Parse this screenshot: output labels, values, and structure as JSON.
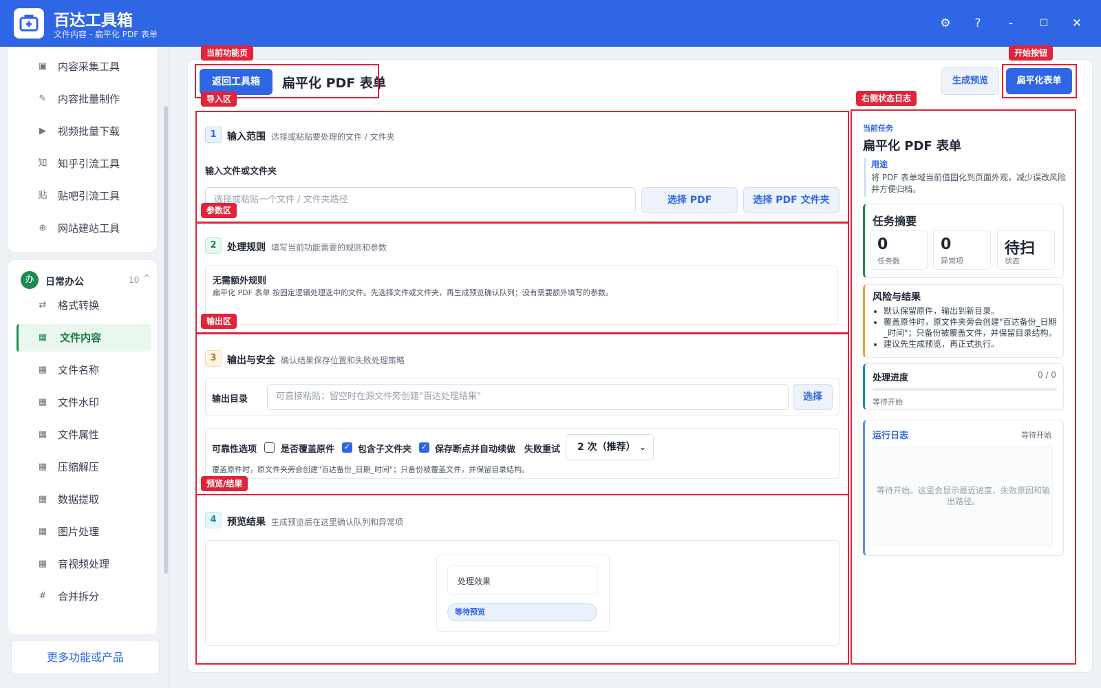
{
  "app": {
    "title": "百达工具箱",
    "subtitle": "文件内容 - 扁平化 PDF 表单"
  },
  "window_controls": {
    "settings": "⚙",
    "help": "?",
    "minimize": "-",
    "maximize": "☐",
    "close": "✕"
  },
  "sidebar": {
    "top_items": [
      {
        "label": "内容采集工具",
        "icon": "▣"
      },
      {
        "label": "内容批量制作",
        "icon": "✎"
      },
      {
        "label": "视频批量下载",
        "icon": "▶"
      },
      {
        "label": "知乎引流工具",
        "icon": "知"
      },
      {
        "label": "贴吧引流工具",
        "icon": "贴"
      },
      {
        "label": "网站建站工具",
        "icon": "⊕"
      }
    ],
    "group": {
      "badge": "办",
      "title": "日常办公",
      "count": "10",
      "caret": "^"
    },
    "group_items": [
      {
        "label": "格式转换",
        "icon": "⇄"
      },
      {
        "label": "文件内容",
        "icon": "▦"
      },
      {
        "label": "文件名称",
        "icon": "▦"
      },
      {
        "label": "文件水印",
        "icon": "▦"
      },
      {
        "label": "文件属性",
        "icon": "▦"
      },
      {
        "label": "压缩解压",
        "icon": "▦"
      },
      {
        "label": "数据提取",
        "icon": "▦"
      },
      {
        "label": "图片处理",
        "icon": "▦"
      },
      {
        "label": "音视频处理",
        "icon": "▦"
      },
      {
        "label": "合并拆分",
        "icon": "#"
      }
    ],
    "active_index": 1,
    "more_button": "更多功能或产品"
  },
  "header": {
    "back_button": "返回工具箱",
    "page_title": "扁平化 PDF 表单",
    "preview_button": "生成预览",
    "start_button": "扁平化表单"
  },
  "annotations": {
    "current_page": "当前功能页",
    "start_button": "开始按钮",
    "import_area": "导入区",
    "right_log": "右侧状态日志",
    "params_area": "参数区",
    "output_area": "输出区",
    "preview_area": "预览/结果"
  },
  "section1": {
    "num": "1",
    "title": "输入范围",
    "desc": "选择或粘贴要处理的文件 / 文件夹",
    "field_label": "输入文件或文件夹",
    "input_placeholder": "选择或粘贴一个文件 / 文件夹路径",
    "btn_pdf": "选择 PDF",
    "btn_folder": "选择 PDF 文件夹"
  },
  "section2": {
    "num": "2",
    "title": "处理规则",
    "desc": "填写当前功能需要的规则和参数",
    "card_title": "无需额外规则",
    "card_text": "扁平化 PDF 表单 按固定逻辑处理选中的文件。先选择文件或文件夹，再生成预览确认队列；没有需要额外填写的参数。"
  },
  "section3": {
    "num": "3",
    "title": "输出与安全",
    "desc": "确认结果保存位置和失败处理策略",
    "output_label": "输出目录",
    "output_placeholder": "可直接粘贴；留空时在源文件旁创建\"百达处理结果\"",
    "choose_button": "选择",
    "reliability_label": "可靠性选项",
    "opt_overwrite": "是否覆盖原件",
    "opt_subfolders": "包含子文件夹",
    "opt_resume": "保存断点并自动续做",
    "retry_label": "失败重试",
    "retry_value": "2 次（推荐）",
    "note": "覆盖原件时，原文件夹旁会创建\"百达备份_日期_时间\"；只备份被覆盖文件，并保留目录结构。",
    "overwrite_checked": false,
    "subfolders_checked": true,
    "resume_checked": true
  },
  "section4": {
    "num": "4",
    "title": "预览结果",
    "desc": "生成预览后在这里确认队列和异常项",
    "effect_label": "处理效果",
    "pending_badge": "等待预览"
  },
  "right_panel": {
    "task_label": "当前任务",
    "task_title": "扁平化 PDF 表单",
    "purpose_label": "用途",
    "purpose_text": "将 PDF 表单域当前值固化到页面外观，减少误改风险并方便归档。",
    "summary_title": "任务摘要",
    "stats": [
      {
        "value": "0",
        "label": "任务数"
      },
      {
        "value": "0",
        "label": "异常项"
      },
      {
        "value": "待扫",
        "label": "状态"
      }
    ],
    "risk_title": "风险与结果",
    "risks": [
      "默认保留原件，输出到新目录。",
      "覆盖原件时，原文件夹旁会创建\"百达备份_日期_时间\"；只备份被覆盖文件，并保留目录结构。",
      "建议先生成预览，再正式执行。"
    ],
    "progress_title": "处理进度",
    "progress_count": "0 / 0",
    "progress_value": 0,
    "progress_status": "等待开始",
    "log_title": "运行日志",
    "log_status": "等待开始",
    "log_empty": "等待开始。这里会显示最近进度、失败原因和输出路径。"
  },
  "colors": {
    "brand_blue": "#2f66e3",
    "active_green": "#1f8a52",
    "annotation_red": "#e0243a"
  }
}
